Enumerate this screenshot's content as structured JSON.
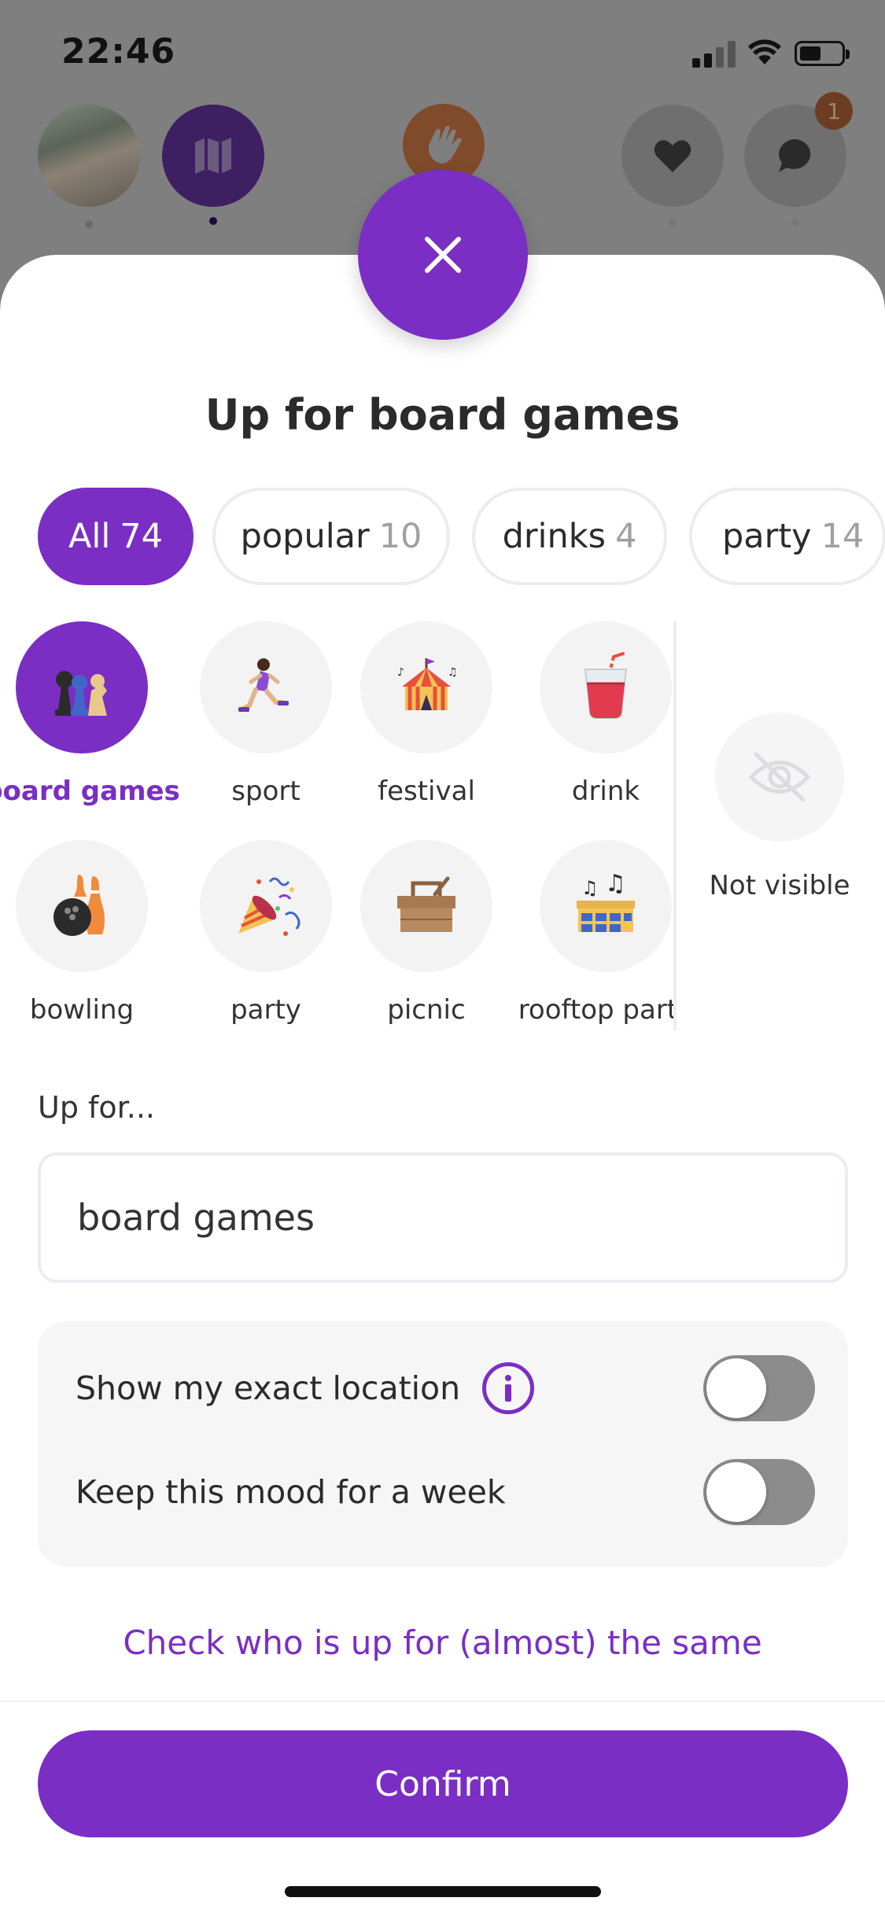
{
  "status_bar": {
    "time": "22:46"
  },
  "nav": {
    "chat_badge_count": "1"
  },
  "sheet": {
    "title": "Up for board games",
    "chips": [
      {
        "label": "All",
        "count": "74",
        "active": true
      },
      {
        "label": "popular",
        "count": "10",
        "active": false
      },
      {
        "label": "drinks",
        "count": "4",
        "active": false
      },
      {
        "label": "party",
        "count": "14",
        "active": false
      }
    ],
    "tiles": [
      {
        "label": "board games",
        "icon": "board-games-icon",
        "selected": true
      },
      {
        "label": "sport",
        "icon": "runner-icon",
        "selected": false
      },
      {
        "label": "festival",
        "icon": "circus-tent-icon",
        "selected": false
      },
      {
        "label": "drink",
        "icon": "drink-glass-icon",
        "selected": false
      },
      {
        "label": "bowling",
        "icon": "bowling-icon",
        "selected": false
      },
      {
        "label": "party",
        "icon": "party-popper-icon",
        "selected": false
      },
      {
        "label": "picnic",
        "icon": "picnic-basket-icon",
        "selected": false
      },
      {
        "label": "rooftop party",
        "icon": "rooftop-party-icon",
        "selected": false
      }
    ],
    "not_visible_label": "Not visible",
    "up_for_label": "Up for...",
    "up_for_value": "board games",
    "settings": [
      {
        "label": "Show my exact location",
        "has_info": true,
        "on": false
      },
      {
        "label": "Keep this mood for a week",
        "has_info": false,
        "on": false
      }
    ],
    "check_link": "Check who is up for (almost) the same",
    "confirm_label": "Confirm"
  },
  "colors": {
    "accent": "#7a2ec4",
    "toggle_off": "#8c8c8c"
  }
}
